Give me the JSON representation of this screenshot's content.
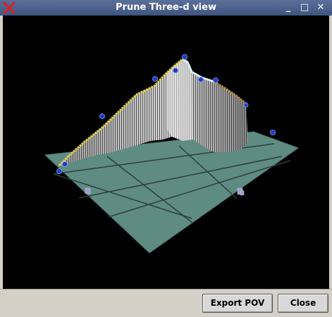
{
  "window": {
    "title": "Prune Three-d view"
  },
  "titlebar_buttons": {
    "minimize": "_",
    "maximize": "□",
    "close": "✕"
  },
  "buttons": {
    "export_label": "Export POV",
    "close_label": "Close"
  },
  "icons": {
    "app": "prune-x-icon"
  },
  "colors": {
    "titlebar": "#4a5f8c",
    "viewport_bg": "#000000",
    "ground": "#5e8c82",
    "sky_track": "#e6d24a",
    "markers": "#1e3cc8"
  }
}
